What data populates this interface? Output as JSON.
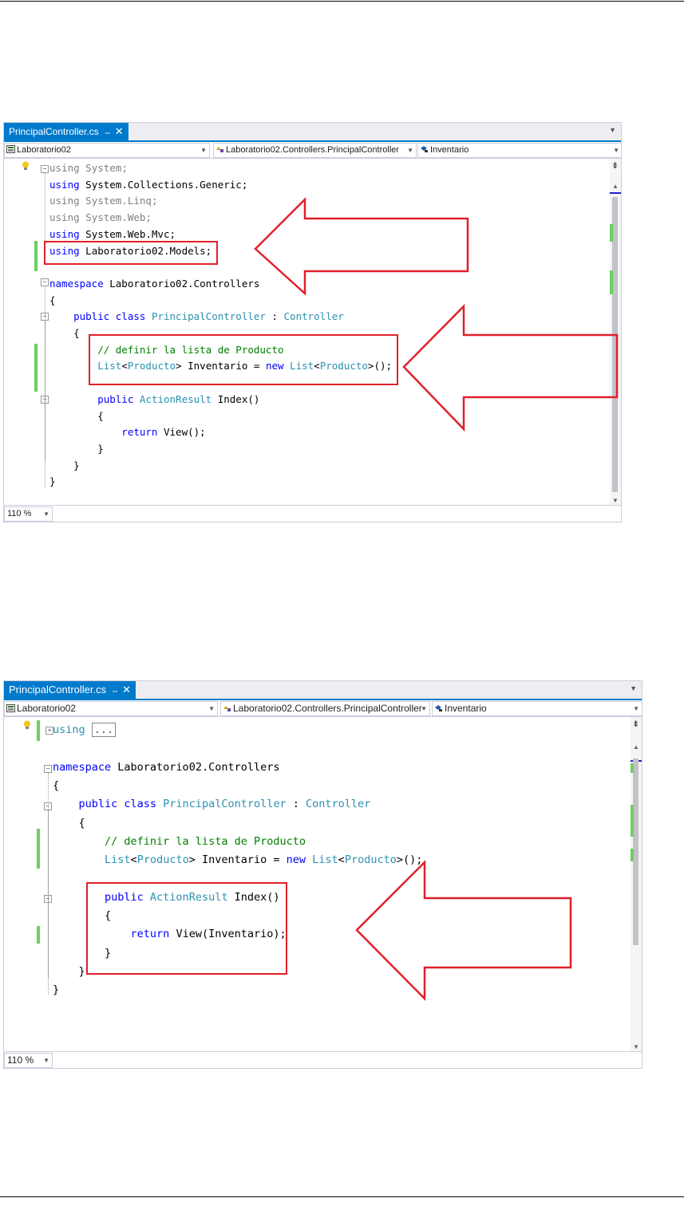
{
  "screenshots": [
    {
      "tab_label": "PrincipalController.cs",
      "tab_pin": "⇔",
      "tab_close": "✕",
      "nav_project": "Laboratorio02",
      "nav_class": "Laboratorio02.Controllers.PrincipalController",
      "nav_member": "Inventario",
      "zoom": "110 %",
      "lines": [
        {
          "tokens": [
            {
              "t": "using",
              "c": "gr"
            },
            {
              "t": " System;",
              "c": "gr"
            }
          ]
        },
        {
          "tokens": [
            {
              "t": "using",
              "c": "kw"
            },
            {
              "t": " System.Collections.Generic;",
              "c": ""
            }
          ]
        },
        {
          "tokens": [
            {
              "t": "using",
              "c": "gr"
            },
            {
              "t": " System.Linq;",
              "c": "gr"
            }
          ]
        },
        {
          "tokens": [
            {
              "t": "using",
              "c": "gr"
            },
            {
              "t": " System.Web;",
              "c": "gr"
            }
          ]
        },
        {
          "tokens": [
            {
              "t": "using",
              "c": "kw"
            },
            {
              "t": " System.Web.Mvc;",
              "c": ""
            }
          ]
        },
        {
          "tokens": [
            {
              "t": "using",
              "c": "kw"
            },
            {
              "t": " Laboratorio02.Models;",
              "c": ""
            }
          ]
        },
        {
          "tokens": []
        },
        {
          "tokens": [
            {
              "t": "namespace",
              "c": "kw"
            },
            {
              "t": " Laboratorio02.Controllers",
              "c": ""
            }
          ]
        },
        {
          "tokens": [
            {
              "t": "{",
              "c": ""
            }
          ]
        },
        {
          "tokens": [
            {
              "t": "    public class ",
              "c": "kw"
            },
            {
              "t": "PrincipalController",
              "c": "ty"
            },
            {
              "t": " : ",
              "c": ""
            },
            {
              "t": "Controller",
              "c": "ty"
            }
          ]
        },
        {
          "tokens": [
            {
              "t": "    {",
              "c": ""
            }
          ]
        },
        {
          "tokens": [
            {
              "t": "        // definir la lista de Producto",
              "c": "cm"
            }
          ]
        },
        {
          "tokens": [
            {
              "t": "        List",
              "c": "ty"
            },
            {
              "t": "<",
              "c": ""
            },
            {
              "t": "Producto",
              "c": "ty"
            },
            {
              "t": "> Inventario = ",
              "c": ""
            },
            {
              "t": "new ",
              "c": "kw"
            },
            {
              "t": "List",
              "c": "ty"
            },
            {
              "t": "<",
              "c": ""
            },
            {
              "t": "Producto",
              "c": "ty"
            },
            {
              "t": ">();",
              "c": ""
            }
          ]
        },
        {
          "tokens": []
        },
        {
          "tokens": [
            {
              "t": "        public ",
              "c": "kw"
            },
            {
              "t": "ActionResult",
              "c": "ty"
            },
            {
              "t": " Index()",
              "c": ""
            }
          ]
        },
        {
          "tokens": [
            {
              "t": "        {",
              "c": ""
            }
          ]
        },
        {
          "tokens": [
            {
              "t": "            return ",
              "c": "kw"
            },
            {
              "t": "View();",
              "c": ""
            }
          ]
        },
        {
          "tokens": [
            {
              "t": "        }",
              "c": ""
            }
          ]
        },
        {
          "tokens": [
            {
              "t": "    }",
              "c": ""
            }
          ]
        },
        {
          "tokens": [
            {
              "t": "}",
              "c": ""
            }
          ]
        }
      ]
    },
    {
      "tab_label": "PrincipalController.cs",
      "tab_pin": "⇔",
      "tab_close": "✕",
      "nav_project": "Laboratorio02",
      "nav_class": "Laboratorio02.Controllers.PrincipalController",
      "nav_member": "Inventario",
      "zoom": "110 %",
      "lines": [
        {
          "tokens": [
            {
              "t": "using",
              "c": "ty"
            },
            {
              "t": " ",
              "c": ""
            },
            {
              "t": "...",
              "c": "collapsed"
            }
          ]
        },
        {
          "tokens": []
        },
        {
          "tokens": [
            {
              "t": "namespace",
              "c": "kw"
            },
            {
              "t": " Laboratorio02.Controllers",
              "c": ""
            }
          ]
        },
        {
          "tokens": [
            {
              "t": "{",
              "c": ""
            }
          ]
        },
        {
          "tokens": [
            {
              "t": "    public class ",
              "c": "kw"
            },
            {
              "t": "PrincipalController",
              "c": "ty"
            },
            {
              "t": " : ",
              "c": ""
            },
            {
              "t": "Controller",
              "c": "ty"
            }
          ]
        },
        {
          "tokens": [
            {
              "t": "    {",
              "c": ""
            }
          ]
        },
        {
          "tokens": [
            {
              "t": "        // definir la lista de Producto",
              "c": "cm"
            }
          ]
        },
        {
          "tokens": [
            {
              "t": "        List",
              "c": "ty"
            },
            {
              "t": "<",
              "c": ""
            },
            {
              "t": "Producto",
              "c": "ty"
            },
            {
              "t": "> Inventario = ",
              "c": ""
            },
            {
              "t": "new ",
              "c": "kw"
            },
            {
              "t": "List",
              "c": "ty"
            },
            {
              "t": "<",
              "c": ""
            },
            {
              "t": "Producto",
              "c": "ty"
            },
            {
              "t": ">();",
              "c": ""
            }
          ]
        },
        {
          "tokens": []
        },
        {
          "tokens": [
            {
              "t": "        public ",
              "c": "kw"
            },
            {
              "t": "ActionResult",
              "c": "ty"
            },
            {
              "t": " Index()",
              "c": ""
            }
          ]
        },
        {
          "tokens": [
            {
              "t": "        {",
              "c": ""
            }
          ]
        },
        {
          "tokens": [
            {
              "t": "            return ",
              "c": "kw"
            },
            {
              "t": "View(Inventario);",
              "c": ""
            }
          ]
        },
        {
          "tokens": [
            {
              "t": "        }",
              "c": ""
            }
          ]
        },
        {
          "tokens": [
            {
              "t": "    }",
              "c": ""
            }
          ]
        },
        {
          "tokens": [
            {
              "t": "}",
              "c": ""
            }
          ]
        }
      ]
    }
  ]
}
